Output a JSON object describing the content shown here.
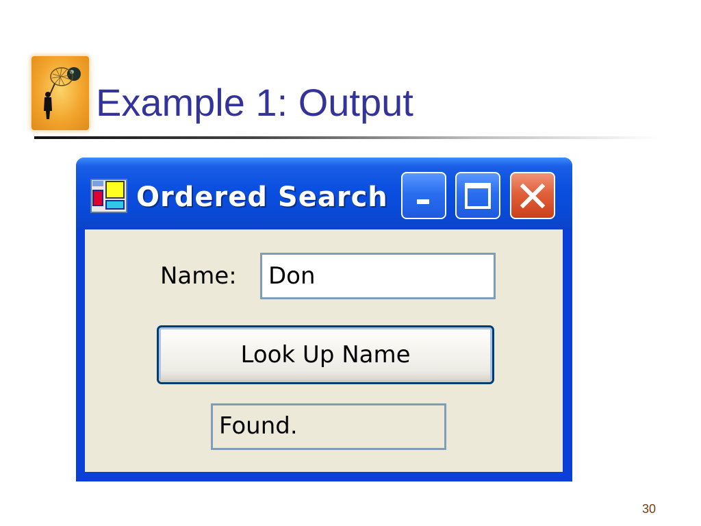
{
  "slide": {
    "title": "Example 1: Output",
    "page_number": "30",
    "icon": "person-with-net-icon"
  },
  "window": {
    "title": "Ordered Search",
    "app_icon": "app-window-icon",
    "controls": {
      "minimize_icon": "minimize-icon",
      "maximize_icon": "maximize-icon",
      "close_icon": "close-icon"
    },
    "colors": {
      "titlebar": "#0a4fe0",
      "client_background": "#ece9d8",
      "close_button": "#e0603a",
      "field_border": "#7f9db9"
    }
  },
  "form": {
    "name_label": "Name:",
    "name_value": "Don",
    "lookup_button_label": "Look Up Name",
    "status_text": "Found."
  }
}
